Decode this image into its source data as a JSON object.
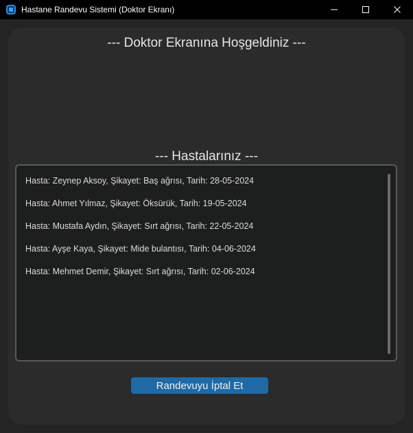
{
  "window": {
    "title": "Hastane Randevu Sistemi (Doktor Ekranı)",
    "controls": [
      "minimize-icon",
      "maximize-icon",
      "close-icon"
    ]
  },
  "main": {
    "welcome_text": "--- Doktor Ekranına Hoşgeldiniz ---",
    "patients_title": "--- Hastalarınız ---",
    "patients": [
      "Hasta: Zeynep Aksoy, Şikayet: Baş ağrısı, Tarih: 28-05-2024",
      "Hasta: Ahmet Yılmaz, Şikayet: Öksürük, Tarih: 19-05-2024",
      "Hasta: Mustafa Aydın, Şikayet: Sırt ağrısı, Tarih: 22-05-2024",
      "Hasta: Ayşe Kaya, Şikayet: Mide bulantısı, Tarih: 04-06-2024",
      "Hasta: Mehmet Demir, Şikayet: Sırt ağrısı, Tarih: 02-06-2024"
    ],
    "cancel_button_label": "Randevuyu İptal Et"
  },
  "colors": {
    "titlebar": "#000000",
    "background": "#242424",
    "panel": "#2b2b2b",
    "button": "#1f6aa5",
    "list_border": "#565b5e"
  }
}
